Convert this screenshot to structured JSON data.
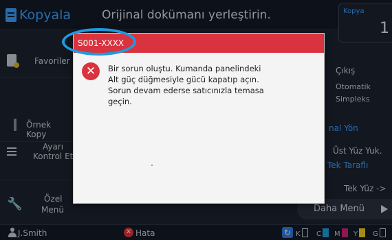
{
  "header": {
    "app_title": "Kopyala",
    "message": "Orijinal dokümanı yerleştirin.",
    "copy_label": "Kopya",
    "copy_count": "1"
  },
  "sidebar": {
    "favorites": "Favoriler",
    "sample_copy": "Örnek Kopy",
    "settings_line1": "Ayarı",
    "settings_line2": "Kontrol Et",
    "special_line1": "Özel",
    "special_line2": "Menü"
  },
  "right_panel": {
    "output_label": "Çıkış",
    "duplex_line1": "Otomatik",
    "duplex_line2": "Simpleks",
    "orientation_label": "nal Yön",
    "orientation_value": "Üst Yüz Yuk.",
    "sides_label": "Tek Taraflı",
    "sides_value": "Tek Yüz ->",
    "more_menu": "Daha Menü"
  },
  "dialog": {
    "code": "S001-XXXX",
    "message_lines": [
      "Bir sorun oluştu.  Kumanda panelindeki",
      "Alt güç düğmesiyle gücü kapatıp açın.",
      "Sorun devam ederse satıcınızla temasa",
      "geçin."
    ],
    "icon": "error-x-icon"
  },
  "status_bar": {
    "user": "J.Smith",
    "error_label": "Hata",
    "ink": [
      {
        "label": "K",
        "color": "#c9ced8"
      },
      {
        "label": "C",
        "color": "#1ca0e0"
      },
      {
        "label": "M",
        "color": "#d0237a"
      },
      {
        "label": "Y",
        "color": "#f0d020"
      },
      {
        "label": "G",
        "color": "#888888"
      }
    ]
  },
  "colors": {
    "accent": "#3aa0ff",
    "error": "#d8333e",
    "highlight": "#1e9be0"
  }
}
